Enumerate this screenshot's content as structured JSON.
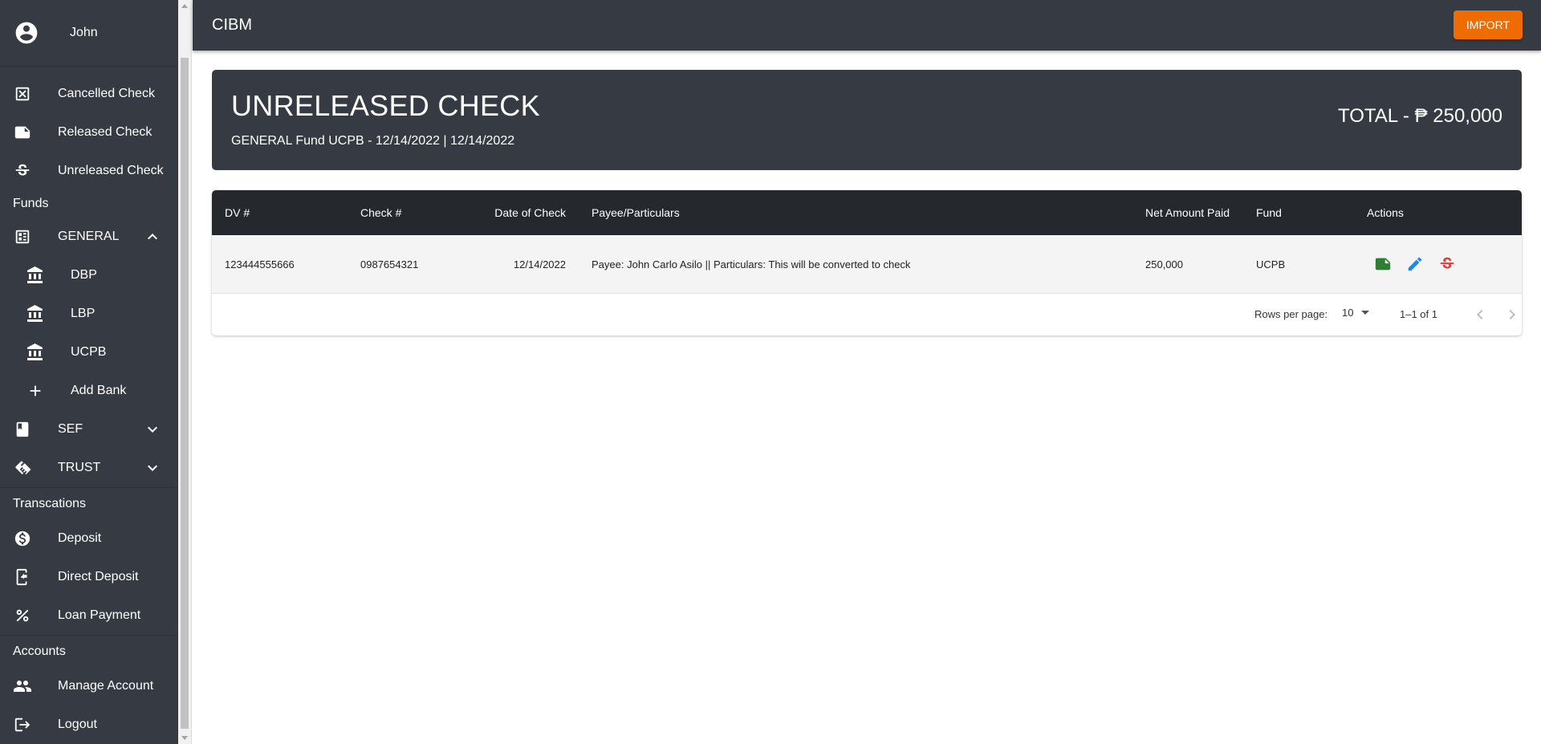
{
  "app": {
    "title": "CIBM",
    "import_label": "IMPORT"
  },
  "sidebar": {
    "user": {
      "name": "John",
      "icon": "account-circle-icon"
    },
    "checks": [
      {
        "label": "Cancelled Check",
        "icon": "cancel-box-icon"
      },
      {
        "label": "Released Check",
        "icon": "note-icon"
      },
      {
        "label": "Unreleased Check",
        "icon": "strikethrough-icon"
      }
    ],
    "funds_heading": "Funds",
    "funds": {
      "general": {
        "label": "GENERAL",
        "icon": "fund-icon",
        "expanded": true
      },
      "banks": [
        {
          "label": "DBP",
          "icon": "bank-icon"
        },
        {
          "label": "LBP",
          "icon": "bank-icon"
        },
        {
          "label": "UCPB",
          "icon": "bank-icon"
        }
      ],
      "add_bank": {
        "label": "Add Bank",
        "icon": "plus-icon"
      },
      "sef": {
        "label": "SEF",
        "icon": "book-icon"
      },
      "trust": {
        "label": "TRUST",
        "icon": "handshake-icon"
      }
    },
    "transactions_heading": "Transcations",
    "transactions": [
      {
        "label": "Deposit",
        "icon": "dollar-circle-icon"
      },
      {
        "label": "Direct Deposit",
        "icon": "phone-deposit-icon"
      },
      {
        "label": "Loan Payment",
        "icon": "percent-icon"
      }
    ],
    "accounts_heading": "Accounts",
    "accounts": [
      {
        "label": "Manage Account",
        "icon": "people-icon"
      },
      {
        "label": "Logout",
        "icon": "logout-icon"
      }
    ]
  },
  "header": {
    "title": "UNRELEASED CHECK",
    "subtitle": "GENERAL Fund UCPB - 12/14/2022 | 12/14/2022",
    "total": "TOTAL - ₱ 250,000"
  },
  "table": {
    "columns": {
      "dv": "DV #",
      "check": "Check #",
      "date": "Date of Check",
      "payee": "Payee/Particulars",
      "net": "Net Amount Paid",
      "fund": "Fund",
      "actions": "Actions"
    },
    "rows": [
      {
        "dv": "123444555666",
        "check": "0987654321",
        "date": "12/14/2022",
        "payee": "Payee: John Carlo Asilo || Particulars: This will be converted to check",
        "net": "250,000",
        "fund": "UCPB"
      }
    ],
    "footer": {
      "rows_per_page_label": "Rows per page:",
      "rows_per_page": "10",
      "range": "1–1 of 1"
    }
  },
  "colors": {
    "sidebar_bg": "#363b43",
    "table_header_bg": "#25292e",
    "import_btn": "#ef6c00",
    "release_action": "#2e7d32",
    "edit_action": "#1e88e5",
    "cancel_action": "#e53935"
  }
}
